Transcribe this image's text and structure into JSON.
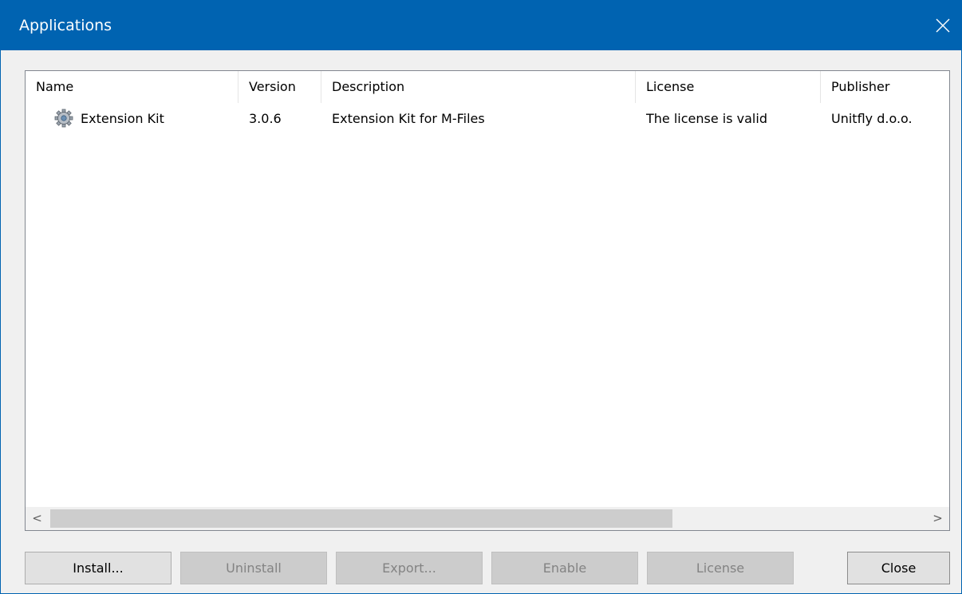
{
  "window": {
    "title": "Applications",
    "close_glyph": "close-icon"
  },
  "list": {
    "columns": [
      {
        "label": "Name"
      },
      {
        "label": "Version"
      },
      {
        "label": "Description"
      },
      {
        "label": "License"
      },
      {
        "label": "Publisher"
      }
    ],
    "rows": [
      {
        "icon": "gear-icon",
        "name": "Extension Kit",
        "version": "3.0.6",
        "description": "Extension Kit for M-Files",
        "license": "The license is valid",
        "publisher": "Unitfly d.o.o."
      }
    ],
    "scroll_left": "<",
    "scroll_right": ">"
  },
  "buttons": {
    "install": "Install...",
    "uninstall": "Uninstall",
    "export": "Export...",
    "enable": "Enable",
    "license": "License",
    "close": "Close"
  },
  "colors": {
    "titlebar": "#0063b1",
    "disabled_button": "#cccccc",
    "button": "#e1e1e1"
  }
}
